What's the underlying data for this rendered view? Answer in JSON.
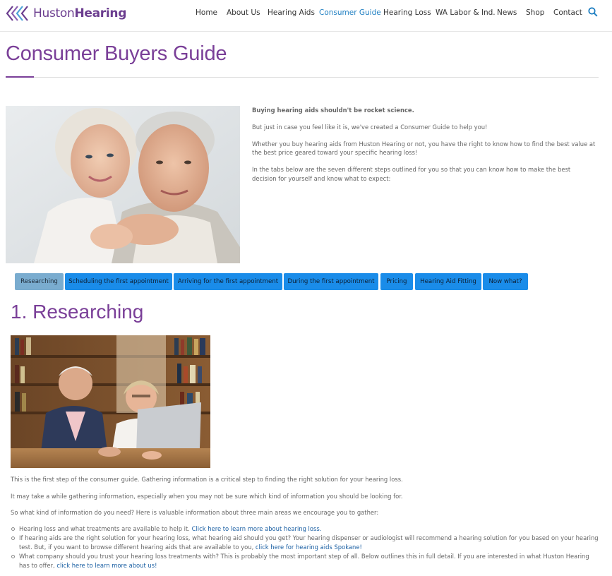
{
  "logo": {
    "light": "Huston",
    "bold": "Hearing"
  },
  "nav": {
    "items": [
      {
        "label": "Home"
      },
      {
        "label": "About Us"
      },
      {
        "label": "Hearing Aids"
      },
      {
        "label": "Consumer Guide"
      },
      {
        "label": "Hearing Loss"
      },
      {
        "label": "WA Labor & Ind."
      },
      {
        "label": "News"
      },
      {
        "label": "Shop"
      },
      {
        "label": "Contact"
      }
    ],
    "active": "Consumer Guide"
  },
  "page": {
    "title": "Consumer Buyers Guide"
  },
  "intro": {
    "lead": "Buying hearing aids shouldn't be rocket science.",
    "p1": "But just in case you feel like it is, we've created a Consumer Guide to help you!",
    "p2": "Whether you buy hearing aids from Huston Hearing or not, you have the right to know how to find the best value at the best price geared toward your specific hearing loss!",
    "p3": "In the tabs below are the seven different steps outlined for you so that you can know how to make the best decision for yourself and know what to expect:"
  },
  "tabs": [
    {
      "label": "Researching"
    },
    {
      "label": "Scheduling the first appointment"
    },
    {
      "label": "Arriving for the first appointment"
    },
    {
      "label": "During the first appointment"
    },
    {
      "label": "Pricing"
    },
    {
      "label": "Hearing Aid Fitting"
    },
    {
      "label": "Now what?"
    }
  ],
  "section": {
    "heading": "1. Researching",
    "p1": "This is the first step of the consumer guide.  Gathering information is a critical step to finding the right solution for your hearing loss.",
    "p2": "It may take a while gathering information, especially when you may not be sure which kind of information you should be looking for.",
    "p3": "So what kind of information do you need?  Here is valuable information about three main areas we encourage you to gather:",
    "bullets": [
      {
        "text": "Hearing loss and what treatments are available to help it.  ",
        "link": "Click here to learn more about hearing loss."
      },
      {
        "text": "If hearing aids are the right solution for your hearing loss, what hearing aid should you get?  Your hearing dispenser or audiologist will recommend a hearing solution for you based on your hearing test.  But, if you want to browse different hearing aids that are available to you, ",
        "link": "click here for hearing aids Spokane!"
      },
      {
        "text": "What company should you trust your hearing loss treatments with?  This is probably the most important step of all.  Below outlines this in full detail.  If you are interested in what Huston Hearing has to offer, ",
        "link": "click here to learn more about us!"
      }
    ]
  },
  "colors": {
    "brand": "#7a3f98",
    "tab": "#1a8ce9",
    "tab_active": "#7aaccf",
    "nav_active": "#1f7fc2",
    "link": "#1a5fa3"
  }
}
